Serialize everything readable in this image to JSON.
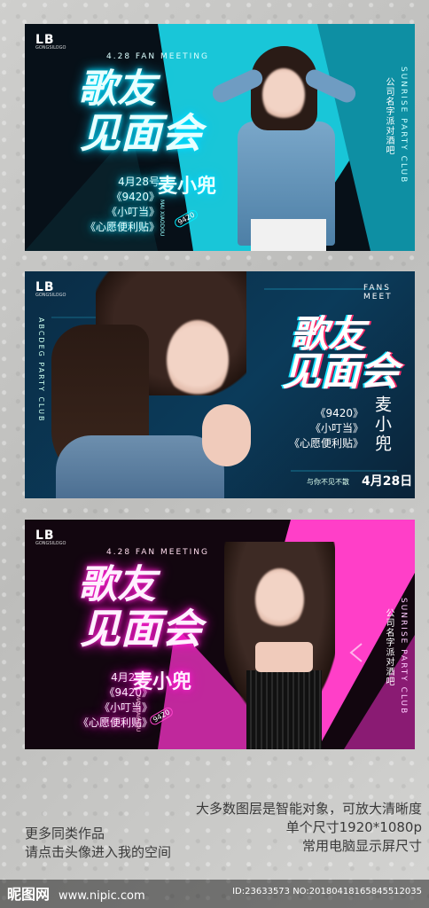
{
  "banner1": {
    "logo": "LB",
    "logo_sub": "GONGSILOGO",
    "event_tag": "4.28 FAN MEETING",
    "title_line1": "歌友",
    "title_line2": "见面会",
    "date": "4月28号",
    "songs": [
      "《9420》",
      "《小叮当》",
      "《心愿便利贴》"
    ],
    "artist_name": "麦小兜",
    "artist_pinyin": "MAI XIAODOU",
    "artist_badge": "9420",
    "side_en": "SUNRISE PARTY CLUB",
    "side_cn": "公司名字派对酒吧"
  },
  "banner2": {
    "logo": "LB",
    "logo_sub": "GONGSILOGO",
    "fans_meet": "FANS MEET",
    "title_line1": "歌友",
    "title_line2": "见面会",
    "songs": [
      "《9420》",
      "《小叮当》",
      "《心愿便利贴》"
    ],
    "artist_name": "麦小兜",
    "tagline": "与你不见不散",
    "date": "4月28日",
    "side_en": "ABCDEG PARTY CLUB"
  },
  "banner3": {
    "logo": "LB",
    "logo_sub": "GONGSILOGO",
    "event_tag": "4.28 FAN MEETING",
    "title_line1": "歌友",
    "title_line2": "见面会",
    "date": "4月28号",
    "songs": [
      "《9420》",
      "《小叮当》",
      "《心愿便利贴》"
    ],
    "artist_name": "麦小兜",
    "artist_pinyin": "MAI XIAODOU",
    "artist_badge": "9420",
    "side_en": "SUNRISE PARTY CLUB",
    "side_cn": "公司名字派对酒吧"
  },
  "footer": {
    "line_right_1": "大多数图层是智能对象，可放大清晰度",
    "line_right_2": "单个尺寸1920*1080p",
    "line_right_3": "常用电脑显示屏尺寸",
    "line_left_1": "更多同类作品",
    "line_left_2": "请点击头像进入我的空间"
  },
  "watermark": {
    "brand": "昵图网",
    "url": "www.nipic.com",
    "id_text": "ID:23633573 NO:20180418165845512035"
  },
  "colors": {
    "cyan": "#00e5ff",
    "pink": "#ff2bd6",
    "navy": "#0b3b5a"
  }
}
